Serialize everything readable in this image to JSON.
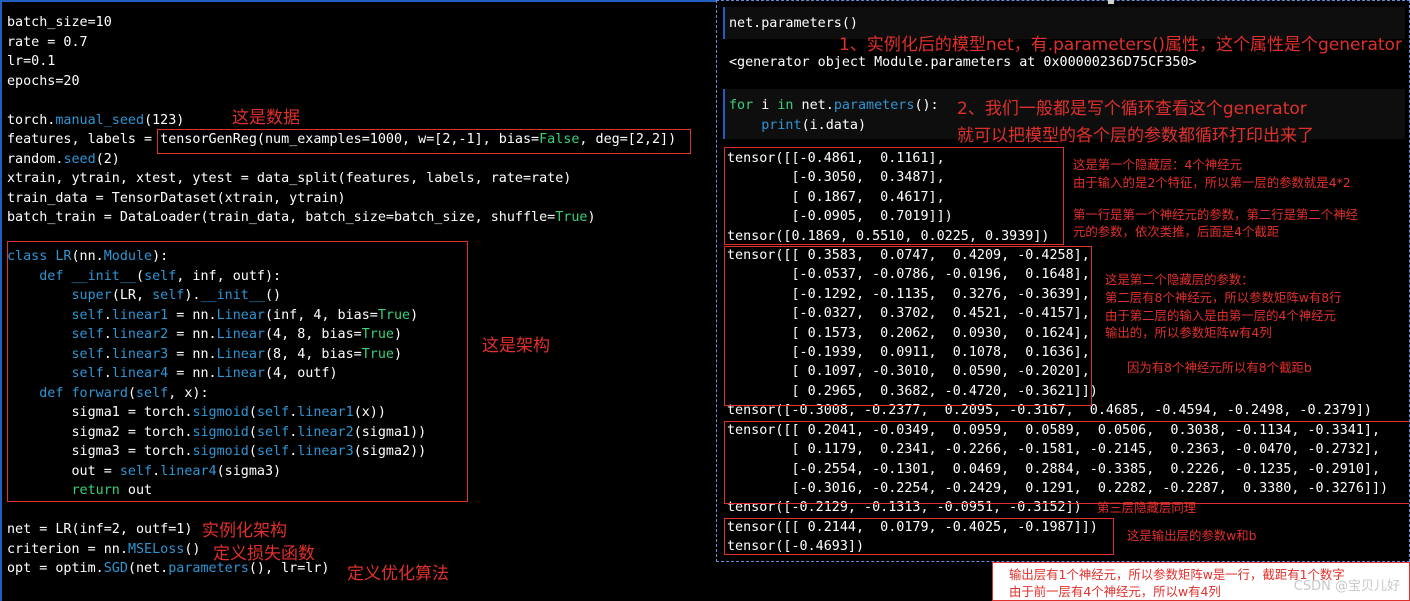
{
  "left": {
    "code_lines": [
      {
        "html": "batch_size=10"
      },
      {
        "html": "rate = 0.7"
      },
      {
        "html": "lr=0.1"
      },
      {
        "html": "epochs=20"
      },
      {
        "html": ""
      },
      {
        "html": "torch.<span class='fn'>manual_seed</span>(123)"
      },
      {
        "html": "features, labels = tensorGenReg(num_examples=1000, w=[2,-1], bias=<span class='bool'>False</span>, deg=[2,2])"
      },
      {
        "html": "random.<span class='fn'>seed</span>(2)"
      },
      {
        "html": "xtrain, ytrain, xtest, ytest = data_split(features, labels, rate=rate)"
      },
      {
        "html": "train_data = TensorDataset(xtrain, ytrain)"
      },
      {
        "html": "batch_train = DataLoader(train_data, batch_size=batch_size, shuffle=<span class='bool'>True</span>)"
      },
      {
        "html": ""
      },
      {
        "html": "<span class='kw'>class</span> <span class='fn'>LR</span>(nn.<span class='fn'>Module</span>):"
      },
      {
        "html": "    <span class='kw'>def</span> <span class='fn'>__init__</span>(<span class='kw'>self</span>, inf, outf):"
      },
      {
        "html": "        <span class='kw'>super</span>(LR, <span class='kw'>self</span>).<span class='fn'>__init__</span>()"
      },
      {
        "html": "        <span class='kw'>self</span>.<span class='kw'>linear1</span> = nn.<span class='fn'>Linear</span>(inf, 4, bias=<span class='bool'>True</span>)"
      },
      {
        "html": "        <span class='kw'>self</span>.<span class='kw'>linear2</span> = nn.<span class='fn'>Linear</span>(4, 8, bias=<span class='bool'>True</span>)"
      },
      {
        "html": "        <span class='kw'>self</span>.<span class='kw'>linear3</span> = nn.<span class='fn'>Linear</span>(8, 4, bias=<span class='bool'>True</span>)"
      },
      {
        "html": "        <span class='kw'>self</span>.<span class='kw'>linear4</span> = nn.<span class='fn'>Linear</span>(4, outf)"
      },
      {
        "html": "    <span class='kw'>def</span> <span class='fn'>forward</span>(<span class='kw'>self</span>, x):"
      },
      {
        "html": "        sigma1 = torch.<span class='fn'>sigmoid</span>(<span class='kw'>self</span>.<span class='fn'>linear1</span>(x))"
      },
      {
        "html": "        sigma2 = torch.<span class='fn'>sigmoid</span>(<span class='kw'>self</span>.<span class='fn'>linear2</span>(sigma1))"
      },
      {
        "html": "        sigma3 = torch.<span class='fn'>sigmoid</span>(<span class='kw'>self</span>.<span class='fn'>linear3</span>(sigma2))"
      },
      {
        "html": "        out = <span class='kw'>self</span>.<span class='fn'>linear4</span>(sigma3)"
      },
      {
        "html": "        <span class='bool'>return</span> out"
      },
      {
        "html": ""
      },
      {
        "html": "net = LR(inf=2, outf=1)"
      },
      {
        "html": "criterion = nn.<span class='fn'>MSELoss</span>()"
      },
      {
        "html": "opt = optim.<span class='fn'>SGD</span>(net.<span class='fn'>parameters</span>(), lr=lr)"
      }
    ],
    "notes": {
      "data": "这是数据",
      "arch": "这是架构",
      "instantiate": "实例化架构",
      "loss": "定义损失函数",
      "optim": "定义优化算法"
    }
  },
  "right": {
    "cell1_code": "net.parameters()",
    "cell1_output": "<generator object Module.parameters at 0x00000236D75CF350>",
    "cell2_line1": "for i in net.parameters():",
    "cell2_line2": "    print(i.data)",
    "notes": {
      "n1": "1、实例化后的模型net，有.parameters()属性，这个属性是个generator",
      "n2": "2、我们一般都是写个循环查看这个generator",
      "n3": "就可以把模型的各个层的参数都循环打印出来了",
      "layer1_a": "这是第一个隐藏层：4个神经元",
      "layer1_b": "由于输入的是2个特征，所以第一层的参数就是4*2",
      "layer1_c": "第一行是第一个神经元的参数，第二行是第二个神经",
      "layer1_d": "元的参数，依次类推，后面是4个截距",
      "layer2_a": "这是第二个隐藏层的参数：",
      "layer2_b": "第二层有8个神经元，所以参数矩阵w有8行",
      "layer2_c": "由于第二层的输入是由第一层的4个神经元",
      "layer2_d": "输出的，所以参数矩阵w有4列",
      "layer2_e": "因为有8个神经元所以有8个截距b",
      "layer3": "第三层隐藏层同理",
      "out": "这是输出层的参数w和b",
      "bottom1": "输出层有1个神经元，所以参数矩阵w是一行，截距有1个数字",
      "bottom2": "由于前一层有4个神经元，所以w有4列"
    },
    "tensor_lines": [
      "tensor([[-0.4861,  0.1161],",
      "        [-0.3050,  0.3487],",
      "        [ 0.1867,  0.4617],",
      "        [-0.0905,  0.7019]])",
      "tensor([0.1869, 0.5510, 0.0225, 0.3939])",
      "tensor([[ 0.3583,  0.0747,  0.4209, -0.4258],",
      "        [-0.0537, -0.0786, -0.0196,  0.1648],",
      "        [-0.1292, -0.1135,  0.3276, -0.3639],",
      "        [-0.0327,  0.3702,  0.4521, -0.4157],",
      "        [ 0.1573,  0.2062,  0.0930,  0.1624],",
      "        [-0.1939,  0.0911,  0.1078,  0.1636],",
      "        [ 0.1097, -0.3010,  0.0590, -0.2020],",
      "        [ 0.2965,  0.3682, -0.4720, -0.3621]])",
      "tensor([-0.3008, -0.2377,  0.2095, -0.3167,  0.4685, -0.4594, -0.2498, -0.2379])",
      "tensor([[ 0.2041, -0.0349,  0.0959,  0.0589,  0.0506,  0.3038, -0.1134, -0.3341],",
      "        [ 0.1179,  0.2341, -0.2266, -0.1581, -0.2145,  0.2363, -0.0470, -0.2732],",
      "        [-0.2554, -0.1301,  0.0469,  0.2884, -0.3385,  0.2226, -0.1235, -0.2910],",
      "        [-0.3016, -0.2254, -0.2429,  0.1291,  0.2282, -0.2287,  0.3380, -0.3276]])",
      "tensor([-0.2129, -0.1313, -0.0951, -0.3152])",
      "tensor([[ 0.2144,  0.0179, -0.4025, -0.1987]])",
      "tensor([-0.4693])"
    ]
  },
  "watermark": "CSDN @宝贝儿好"
}
